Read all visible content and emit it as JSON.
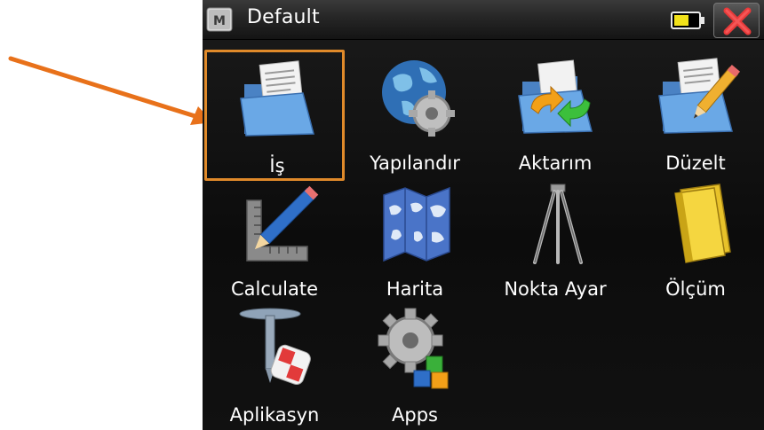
{
  "title_bar": {
    "title": "Default",
    "logo_letter": "M",
    "logo_icon": "m-logo-icon",
    "battery_icon": "battery-icon",
    "close_icon": "close-x-icon"
  },
  "annotation": {
    "arrow_color": "#e8711a",
    "arrow_icon": "arrow-annotation"
  },
  "colors": {
    "selection_border": "#e08a2a",
    "label_text": "#ffffff",
    "background": "#111111"
  },
  "menu": {
    "items": [
      {
        "label": "İş",
        "icon": "folder-document-icon",
        "selected": true
      },
      {
        "label": "Yapılandır",
        "icon": "globe-gear-icon",
        "selected": false
      },
      {
        "label": "Aktarım",
        "icon": "folder-transfer-icon",
        "selected": false
      },
      {
        "label": "Düzelt",
        "icon": "folder-pencil-icon",
        "selected": false
      },
      {
        "label": "Calculate",
        "icon": "pencil-ruler-icon",
        "selected": false
      },
      {
        "label": "Harita",
        "icon": "map-icon",
        "selected": false
      },
      {
        "label": "Nokta Ayar",
        "icon": "tripod-icon",
        "selected": false
      },
      {
        "label": "Ölçüm",
        "icon": "notebook-icon",
        "selected": false
      },
      {
        "label": "Aplikasyn",
        "icon": "survey-nail-icon",
        "selected": false
      },
      {
        "label": "Apps",
        "icon": "gear-blocks-icon",
        "selected": false
      }
    ]
  }
}
